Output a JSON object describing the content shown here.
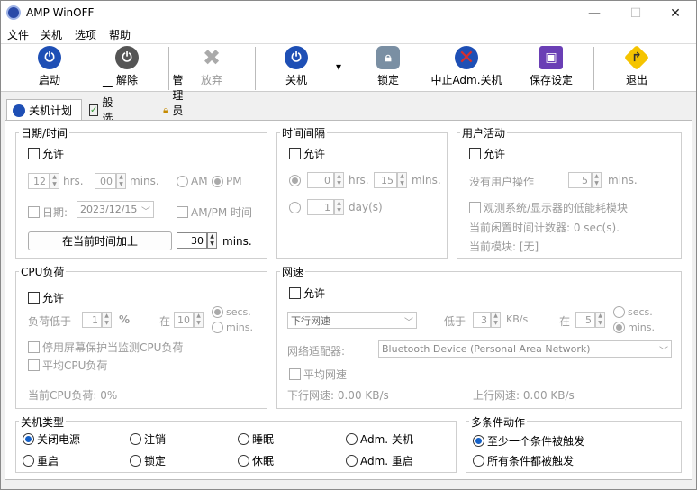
{
  "window": {
    "title": "AMP WinOFF",
    "minimize": "—",
    "maximize": "☐",
    "close": "✕"
  },
  "menu": [
    "文件",
    "关机",
    "选项",
    "帮助"
  ],
  "toolbar": {
    "start": "启动",
    "unlock": "解除",
    "discard": "放弃",
    "shutdown": "关机",
    "dropdown": "▾",
    "lock": "锁定",
    "abort": "中止Adm.关机",
    "save": "保存设定",
    "exit": "退出"
  },
  "tabs": {
    "schedule": "关机计划",
    "general": "一般选项",
    "admin": "管理员选项"
  },
  "datetime": {
    "title": "日期/时间",
    "allow": "允许",
    "hours": "12",
    "hrs": "hrs.",
    "minutes": "00",
    "mins": "mins.",
    "am": "AM",
    "pm": "PM",
    "date_label": "日期:",
    "date": "2023/12/15",
    "ampm_time": "AM/PM 时间",
    "add_button": "在当前时间加上",
    "add_value": "30",
    "add_unit": "mins."
  },
  "interval": {
    "title": "时间间隔",
    "allow": "允许",
    "hours": "0",
    "hrs": "hrs.",
    "minutes": "15",
    "mins": "mins.",
    "days": "1",
    "day_unit": "day(s)"
  },
  "user": {
    "title": "用户活动",
    "allow": "允许",
    "no_op": "没有用户操作",
    "minutes": "5",
    "mins": "mins.",
    "monitor": "观测系统/显示器的低能耗模块",
    "idle": "当前闲置时间计数器: 0 sec(s).",
    "module": "当前模块: [无]"
  },
  "cpu": {
    "title": "CPU负荷",
    "allow": "允许",
    "below": "负荷低于",
    "value": "1",
    "pct": "%",
    "at": "在",
    "time": "10",
    "secs": "secs.",
    "mins": "mins.",
    "stop_saver": "停用屏幕保护当监测CPU负荷",
    "avg": "平均CPU负荷",
    "current": "当前CPU负荷: 0%"
  },
  "net": {
    "title": "网速",
    "allow": "允许",
    "direction": "下行网速",
    "below": "低于",
    "value": "3",
    "unit": "KB/s",
    "at": "在",
    "time": "5",
    "secs": "secs.",
    "mins": "mins.",
    "adapter_label": "网络适配器:",
    "adapter": "Bluetooth Device (Personal Area Network)",
    "avg": "平均网速",
    "down": "下行网速: 0.00 KB/s",
    "up": "上行网速: 0.00 KB/s"
  },
  "shutdown_type": {
    "title": "关机类型",
    "options": [
      "关闭电源",
      "注销",
      "睡眠",
      "Adm. 关机",
      "重启",
      "锁定",
      "休眠",
      "Adm. 重启"
    ]
  },
  "multi": {
    "title": "多条件动作",
    "any": "至少一个条件被触发",
    "all": "所有条件都被触发"
  },
  "colors": {
    "accent": "#1560c6",
    "power_blue": "#1e4fb5",
    "green": "#3a9d3a",
    "gray_icon": "#555555",
    "red": "#d32f2f",
    "yellow": "#f5c400"
  }
}
